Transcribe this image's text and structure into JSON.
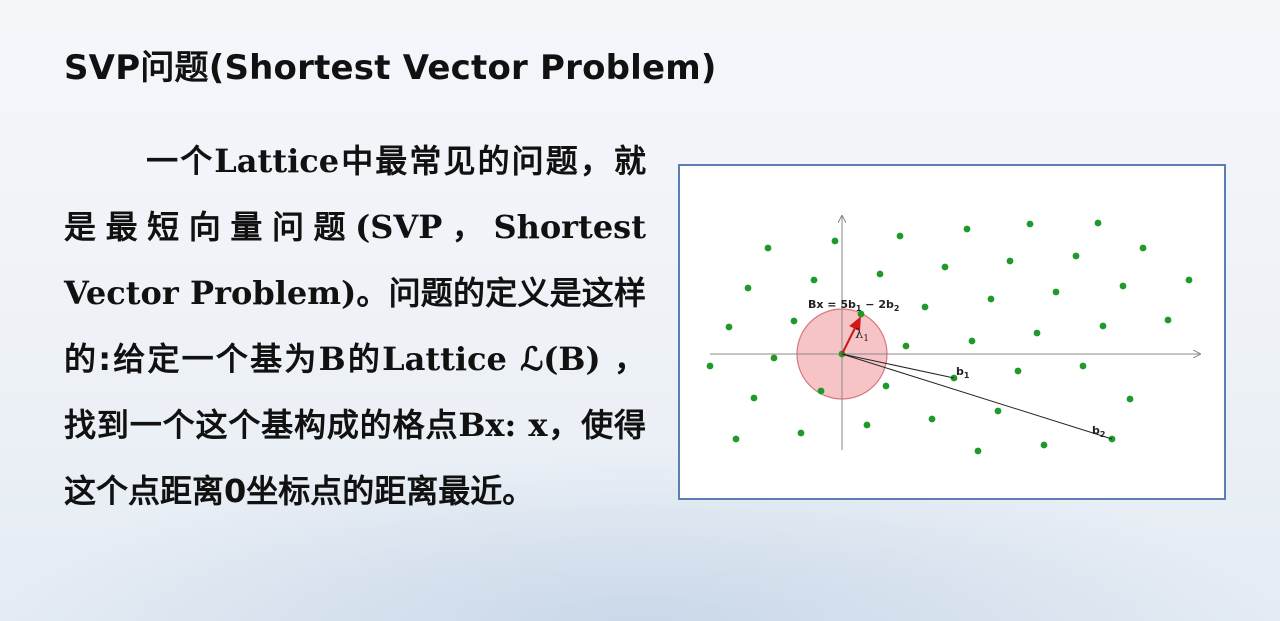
{
  "slide": {
    "title": "SVP问题(Shortest Vector Problem)",
    "paragraph": [
      {
        "text": "一个",
        "font": "cjk"
      },
      {
        "text": "Lattice",
        "font": "latin"
      },
      {
        "text": "中最常见的问题，就是最短向量问题",
        "font": "cjk"
      },
      {
        "text": "(SVP，Shortest Vector Problem)",
        "font": "latin"
      },
      {
        "text": "。问题的定义是这样的:给定一个基为",
        "font": "cjk"
      },
      {
        "text": "B",
        "font": "latin"
      },
      {
        "text": "的",
        "font": "cjk"
      },
      {
        "text": "Lattice ℒ(B)",
        "font": "latin"
      },
      {
        "text": " ，找到一个这个基构成的格点",
        "font": "cjk"
      },
      {
        "text": "Bx: x",
        "font": "latin"
      },
      {
        "text": "，使得这个点距离0坐标点的距离最近。",
        "font": "cjk"
      }
    ]
  },
  "figure": {
    "colors": {
      "point": "#1e9a2a",
      "vector": "#d01818",
      "circle_fill": "#f4b8bc",
      "circle_stroke": "#d9767c",
      "axis": "#888888",
      "border": "#5b7fb3"
    },
    "labels": {
      "bx_prefix": "Bx = 5b",
      "bx_sub1": "1",
      "bx_mid": " − 2b",
      "bx_sub2": "2",
      "lambda": "λ",
      "lambda_sub": "1",
      "b1": "b",
      "b1_sub": "1",
      "b2": "b",
      "b2_sub": "2"
    }
  }
}
